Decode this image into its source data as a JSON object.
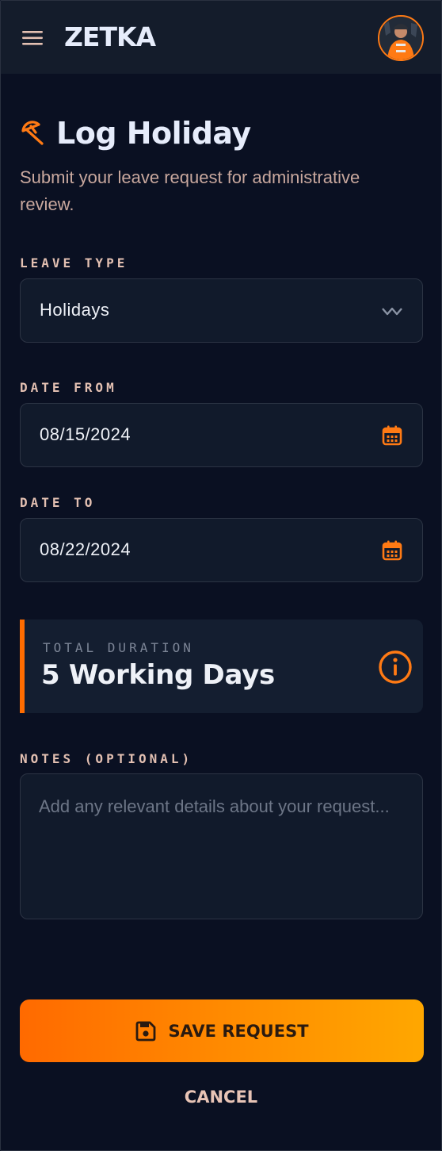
{
  "app": {
    "brand": "ZETKA"
  },
  "header": {
    "menu_icon": "hamburger-menu-icon",
    "avatar_alt": "user avatar"
  },
  "page": {
    "title": "Log Holiday",
    "title_icon": "beach-umbrella-icon",
    "subtitle": "Submit your leave request for administrative review."
  },
  "form": {
    "leave_type": {
      "label": "LEAVE TYPE",
      "value": "Holidays",
      "icon": "chevron-down-icon"
    },
    "date_from": {
      "label": "DATE FROM",
      "value": "08/15/2024",
      "icon": "calendar-icon"
    },
    "date_to": {
      "label": "DATE TO",
      "value": "08/22/2024",
      "icon": "calendar-icon"
    },
    "duration": {
      "label": "TOTAL DURATION",
      "value": "5 Working Days",
      "icon": "info-icon"
    },
    "notes": {
      "label": "NOTES (OPTIONAL)",
      "value": "",
      "placeholder": "Add any relevant details about your request..."
    }
  },
  "actions": {
    "save_label": "SAVE REQUEST",
    "save_icon": "floppy-disk-icon",
    "cancel_label": "CANCEL"
  },
  "colors": {
    "accent": "#ff6c00",
    "accent_end": "#ffa700",
    "background": "#0a1022",
    "topbar": "#141c2b",
    "field": "#111a2b",
    "label": "#e3c0b2"
  }
}
